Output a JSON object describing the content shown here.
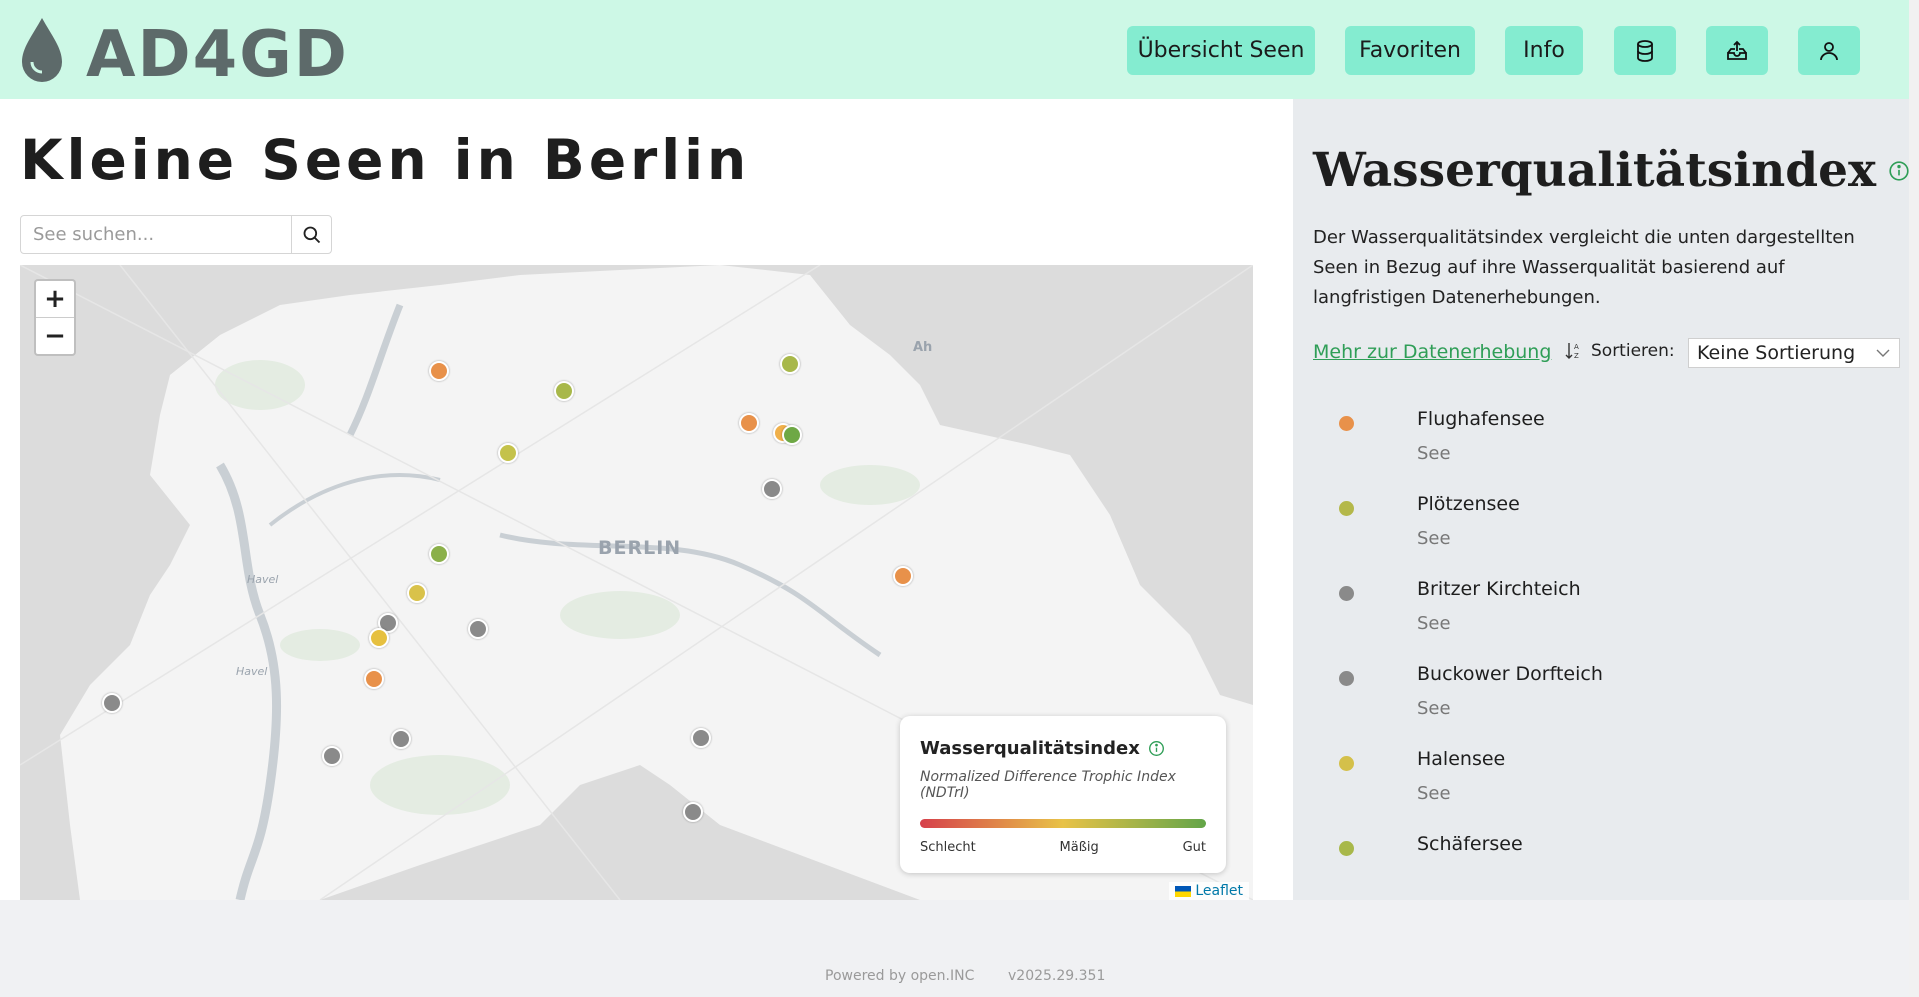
{
  "header": {
    "logo_text": "AD4GD",
    "nav": [
      {
        "label": "Übersicht Seen"
      },
      {
        "label": "Favoriten"
      },
      {
        "label": "Info"
      }
    ],
    "icons": [
      "database-icon",
      "upload-icon",
      "user-icon"
    ]
  },
  "main": {
    "title": "Kleine Seen in Berlin",
    "search": {
      "placeholder": "See suchen..."
    }
  },
  "map": {
    "city_label": "BERLIN",
    "water_labels": [
      "Havel",
      "Havel"
    ],
    "edge_label": "Ah",
    "zoom_in": "+",
    "zoom_out": "−",
    "legend": {
      "title": "Wasserqualitätsindex",
      "subtitle": "Normalized Difference Trophic Index (NDTrI)",
      "low": "Schlecht",
      "mid": "Mäßig",
      "high": "Gut"
    },
    "attribution": "Leaflet",
    "markers": [
      {
        "status": "orange",
        "color": "#e8914a"
      },
      {
        "status": "olive",
        "color": "#a8b84a"
      },
      {
        "status": "olive",
        "color": "#a8b84a"
      },
      {
        "status": "orange",
        "color": "#e8914a"
      },
      {
        "status": "orange",
        "color": "#f0b04a"
      },
      {
        "status": "green",
        "color": "#6ea845"
      },
      {
        "status": "olive",
        "color": "#c4c24a"
      },
      {
        "status": "grey",
        "color": "#8a8a8a"
      },
      {
        "status": "orange",
        "color": "#e8914a"
      },
      {
        "status": "green",
        "color": "#8bb04a"
      },
      {
        "status": "yellow",
        "color": "#d9c24a"
      },
      {
        "status": "grey",
        "color": "#8a8a8a"
      },
      {
        "status": "yellow",
        "color": "#e6c040"
      },
      {
        "status": "grey",
        "color": "#8a8a8a"
      },
      {
        "status": "orange",
        "color": "#e8914a"
      },
      {
        "status": "grey",
        "color": "#8a8a8a"
      },
      {
        "status": "grey",
        "color": "#8a8a8a"
      },
      {
        "status": "grey",
        "color": "#8a8a8a"
      },
      {
        "status": "grey",
        "color": "#8a8a8a"
      },
      {
        "status": "grey",
        "color": "#8a8a8a"
      }
    ]
  },
  "panel": {
    "title": "Wasserqualitätsindex",
    "description": "Der Wasserqualitätsindex vergleicht die unten dargestellten Seen in Bezug auf ihre Wasserqualität basierend auf langfristigen Datenerhebungen.",
    "link": "Mehr zur Datenerhebung",
    "sort_label": "Sortieren:",
    "sort_value": "Keine Sortierung",
    "lakes": [
      {
        "name": "Flughafensee",
        "type": "See",
        "color": "#e8914a"
      },
      {
        "name": "Plötzensee",
        "type": "See",
        "color": "#b4b84a"
      },
      {
        "name": "Britzer Kirchteich",
        "type": "See",
        "color": "#8a8a8a"
      },
      {
        "name": "Buckower Dorfteich",
        "type": "See",
        "color": "#8a8a8a"
      },
      {
        "name": "Halensee",
        "type": "See",
        "color": "#d4c04a"
      },
      {
        "name": "Schäfersee",
        "type": "",
        "color": "#a8b84a"
      }
    ]
  },
  "footer": {
    "powered": "Powered by open.INC",
    "version": "v2025.29.351"
  },
  "colors": {
    "header_bg": "#cdf8e6",
    "nav_button": "#84ecd0",
    "panel_bg": "#e8ebee",
    "link": "#2f9e57"
  }
}
